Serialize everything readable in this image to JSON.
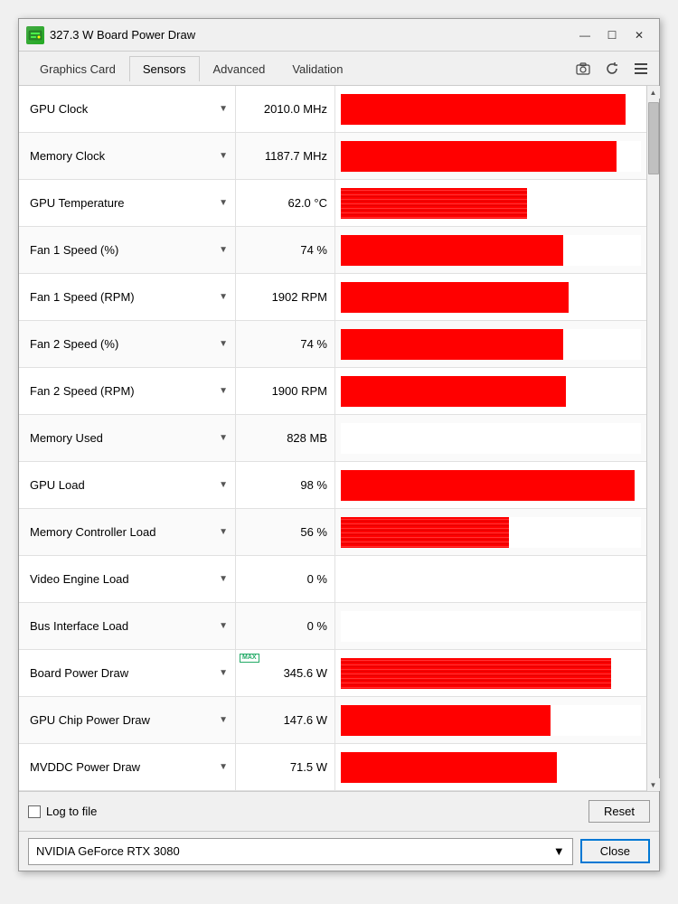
{
  "window": {
    "title": "327.3 W Board Power Draw",
    "icon": "GPU"
  },
  "titleButtons": {
    "minimize": "—",
    "maximize": "☐",
    "close": "✕"
  },
  "tabs": [
    {
      "id": "graphics-card",
      "label": "Graphics Card",
      "active": false
    },
    {
      "id": "sensors",
      "label": "Sensors",
      "active": true
    },
    {
      "id": "advanced",
      "label": "Advanced",
      "active": false
    },
    {
      "id": "validation",
      "label": "Validation",
      "active": false
    }
  ],
  "tabIcons": {
    "camera": "📷",
    "refresh": "↻",
    "menu": "≡"
  },
  "sensors": [
    {
      "id": "gpu-clock",
      "name": "GPU Clock",
      "value": "2010.0 MHz",
      "barPct": 95,
      "barType": "solid",
      "hasMax": false
    },
    {
      "id": "memory-clock",
      "name": "Memory Clock",
      "value": "1187.7 MHz",
      "barPct": 92,
      "barType": "solid",
      "hasMax": false
    },
    {
      "id": "gpu-temp",
      "name": "GPU Temperature",
      "value": "62.0 °C",
      "barPct": 62,
      "barType": "wavy",
      "hasMax": false
    },
    {
      "id": "fan1-pct",
      "name": "Fan 1 Speed (%)",
      "value": "74 %",
      "barPct": 74,
      "barType": "solid",
      "hasMax": false
    },
    {
      "id": "fan1-rpm",
      "name": "Fan 1 Speed (RPM)",
      "value": "1902 RPM",
      "barPct": 76,
      "barType": "solid",
      "hasMax": false
    },
    {
      "id": "fan2-pct",
      "name": "Fan 2 Speed (%)",
      "value": "74 %",
      "barPct": 74,
      "barType": "solid",
      "hasMax": false
    },
    {
      "id": "fan2-rpm",
      "name": "Fan 2 Speed (RPM)",
      "value": "1900 RPM",
      "barPct": 75,
      "barType": "solid",
      "hasMax": false
    },
    {
      "id": "memory-used",
      "name": "Memory Used",
      "value": "828 MB",
      "barPct": 8,
      "barType": "empty",
      "hasMax": false
    },
    {
      "id": "gpu-load",
      "name": "GPU Load",
      "value": "98 %",
      "barPct": 98,
      "barType": "solid",
      "hasMax": false
    },
    {
      "id": "mem-ctrl-load",
      "name": "Memory Controller Load",
      "value": "56 %",
      "barPct": 56,
      "barType": "wavy",
      "hasMax": false
    },
    {
      "id": "video-engine",
      "name": "Video Engine Load",
      "value": "0 %",
      "barPct": 0,
      "barType": "empty",
      "hasMax": false
    },
    {
      "id": "bus-interface",
      "name": "Bus Interface Load",
      "value": "0 %",
      "barPct": 0,
      "barType": "empty",
      "hasMax": false
    },
    {
      "id": "board-power",
      "name": "Board Power Draw",
      "value": "345.6 W",
      "barPct": 90,
      "barType": "wavy",
      "hasMax": true
    },
    {
      "id": "gpu-chip-power",
      "name": "GPU Chip Power Draw",
      "value": "147.6 W",
      "barPct": 70,
      "barType": "solid",
      "hasMax": false
    },
    {
      "id": "mvddc-power",
      "name": "MVDDC Power Draw",
      "value": "71.5 W",
      "barPct": 72,
      "barType": "solid",
      "hasMax": false
    }
  ],
  "footer": {
    "logToFile": "Log to file",
    "resetLabel": "Reset"
  },
  "bottomBar": {
    "gpuName": "NVIDIA GeForce RTX 3080",
    "closeLabel": "Close"
  }
}
